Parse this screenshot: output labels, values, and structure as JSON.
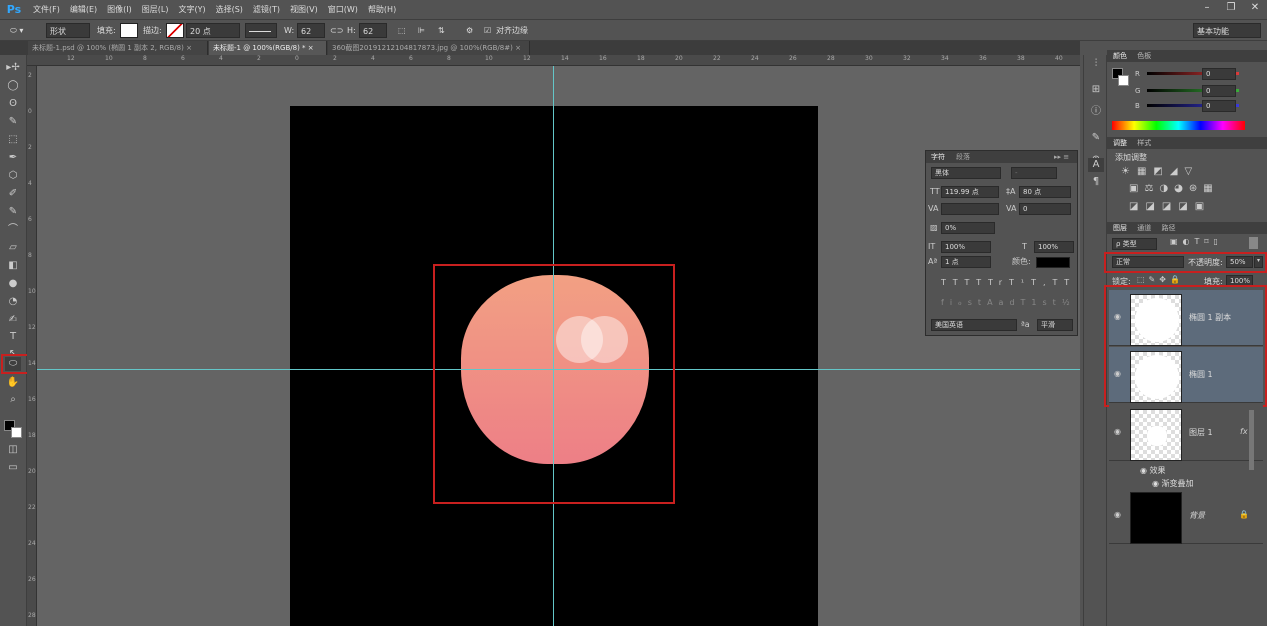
{
  "menubar": {
    "logo": "Ps",
    "items": [
      "文件(F)",
      "编辑(E)",
      "图像(I)",
      "图层(L)",
      "文字(Y)",
      "选择(S)",
      "滤镜(T)",
      "视图(V)",
      "窗口(W)",
      "帮助(H)"
    ],
    "window_controls": [
      "–",
      "❐",
      "✕"
    ]
  },
  "options": {
    "shape_mode": "形状",
    "fill_label": "填充:",
    "stroke_label": "描边:",
    "stroke_size": "20 点",
    "w_label": "W:",
    "w_value": "62 像素",
    "h_label": "H:",
    "h_value": "62 像素",
    "align_edges": "对齐边缘",
    "workspace": "基本功能"
  },
  "tabs": [
    {
      "label": "未标题-1.psd @ 100% (椭圆 1 副本 2, RGB/8)",
      "close": "×"
    },
    {
      "label": "未标题-1 @ 100%(RGB/8) *",
      "close": "×"
    },
    {
      "label": "360截图20191212104817873.jpg @ 100%(RGB/8#)",
      "close": "×"
    }
  ],
  "hruler": [
    "12",
    "10",
    "8",
    "6",
    "4",
    "2",
    "0",
    "2",
    "4",
    "6",
    "8",
    "10",
    "12",
    "14",
    "16",
    "18",
    "20",
    "22",
    "24",
    "26",
    "28",
    "30",
    "32",
    "34",
    "36",
    "38",
    "40"
  ],
  "vruler": [
    "2",
    "0",
    "2",
    "4",
    "6",
    "8",
    "10",
    "12",
    "14",
    "16",
    "18",
    "20",
    "22",
    "24",
    "26",
    "28"
  ],
  "char_panel": {
    "tab1": "字符",
    "tab2": "段落",
    "font": "黑体",
    "style": "-",
    "size": "119.99 点",
    "leading": "80 点",
    "kerning": "",
    "tracking": "0",
    "scale_pct": "0%",
    "vscale": "100%",
    "hscale": "100%",
    "baseline": "1 点",
    "color_label": "颜色:",
    "language": "美国英语",
    "aa_label": "ªa",
    "aa": "平滑",
    "type_styles": [
      "T",
      "T",
      "TT",
      "Tr",
      "T¹",
      "T,",
      "T",
      "T"
    ],
    "ot_styles": [
      "fi",
      "ℴ",
      "st",
      "A",
      "ad",
      "T",
      "1st",
      "½"
    ]
  },
  "color_panel": {
    "tab1": "颜色",
    "tab2": "色板",
    "r_label": "R",
    "g_label": "G",
    "b_label": "B",
    "r": "0",
    "g": "0",
    "b": "0",
    "r_color": "#e03a3a",
    "g_color": "#3ab03a",
    "b_color": "#3a3ae0"
  },
  "adjust_panel": {
    "tab1": "调整",
    "tab2": "样式",
    "title": "添加调整"
  },
  "layers_panel": {
    "tab1": "图层",
    "tab2": "通道",
    "tab3": "路径",
    "filter": "ρ 类型",
    "blend_mode": "正常",
    "opacity_label": "不透明度:",
    "opacity": "50%",
    "lock_label": "锁定:",
    "fill_label": "填充:",
    "fill": "100%",
    "layers": [
      {
        "name": "椭圆 1 副本",
        "selected": true
      },
      {
        "name": "椭圆 1",
        "selected": true
      },
      {
        "name": "图层 1",
        "fx": "fx",
        "effects": "效果",
        "effect1": "渐变叠加"
      },
      {
        "name": "背景"
      }
    ]
  },
  "tools": [
    "▸✢",
    "◯",
    "ʘ",
    "✎",
    "⬚",
    "✒",
    "⬡",
    "✐",
    "✎",
    "⌒",
    "▱",
    "◧",
    "●",
    "◔",
    "✍",
    "T",
    "↖",
    "⬭",
    "✋",
    "⌕"
  ]
}
